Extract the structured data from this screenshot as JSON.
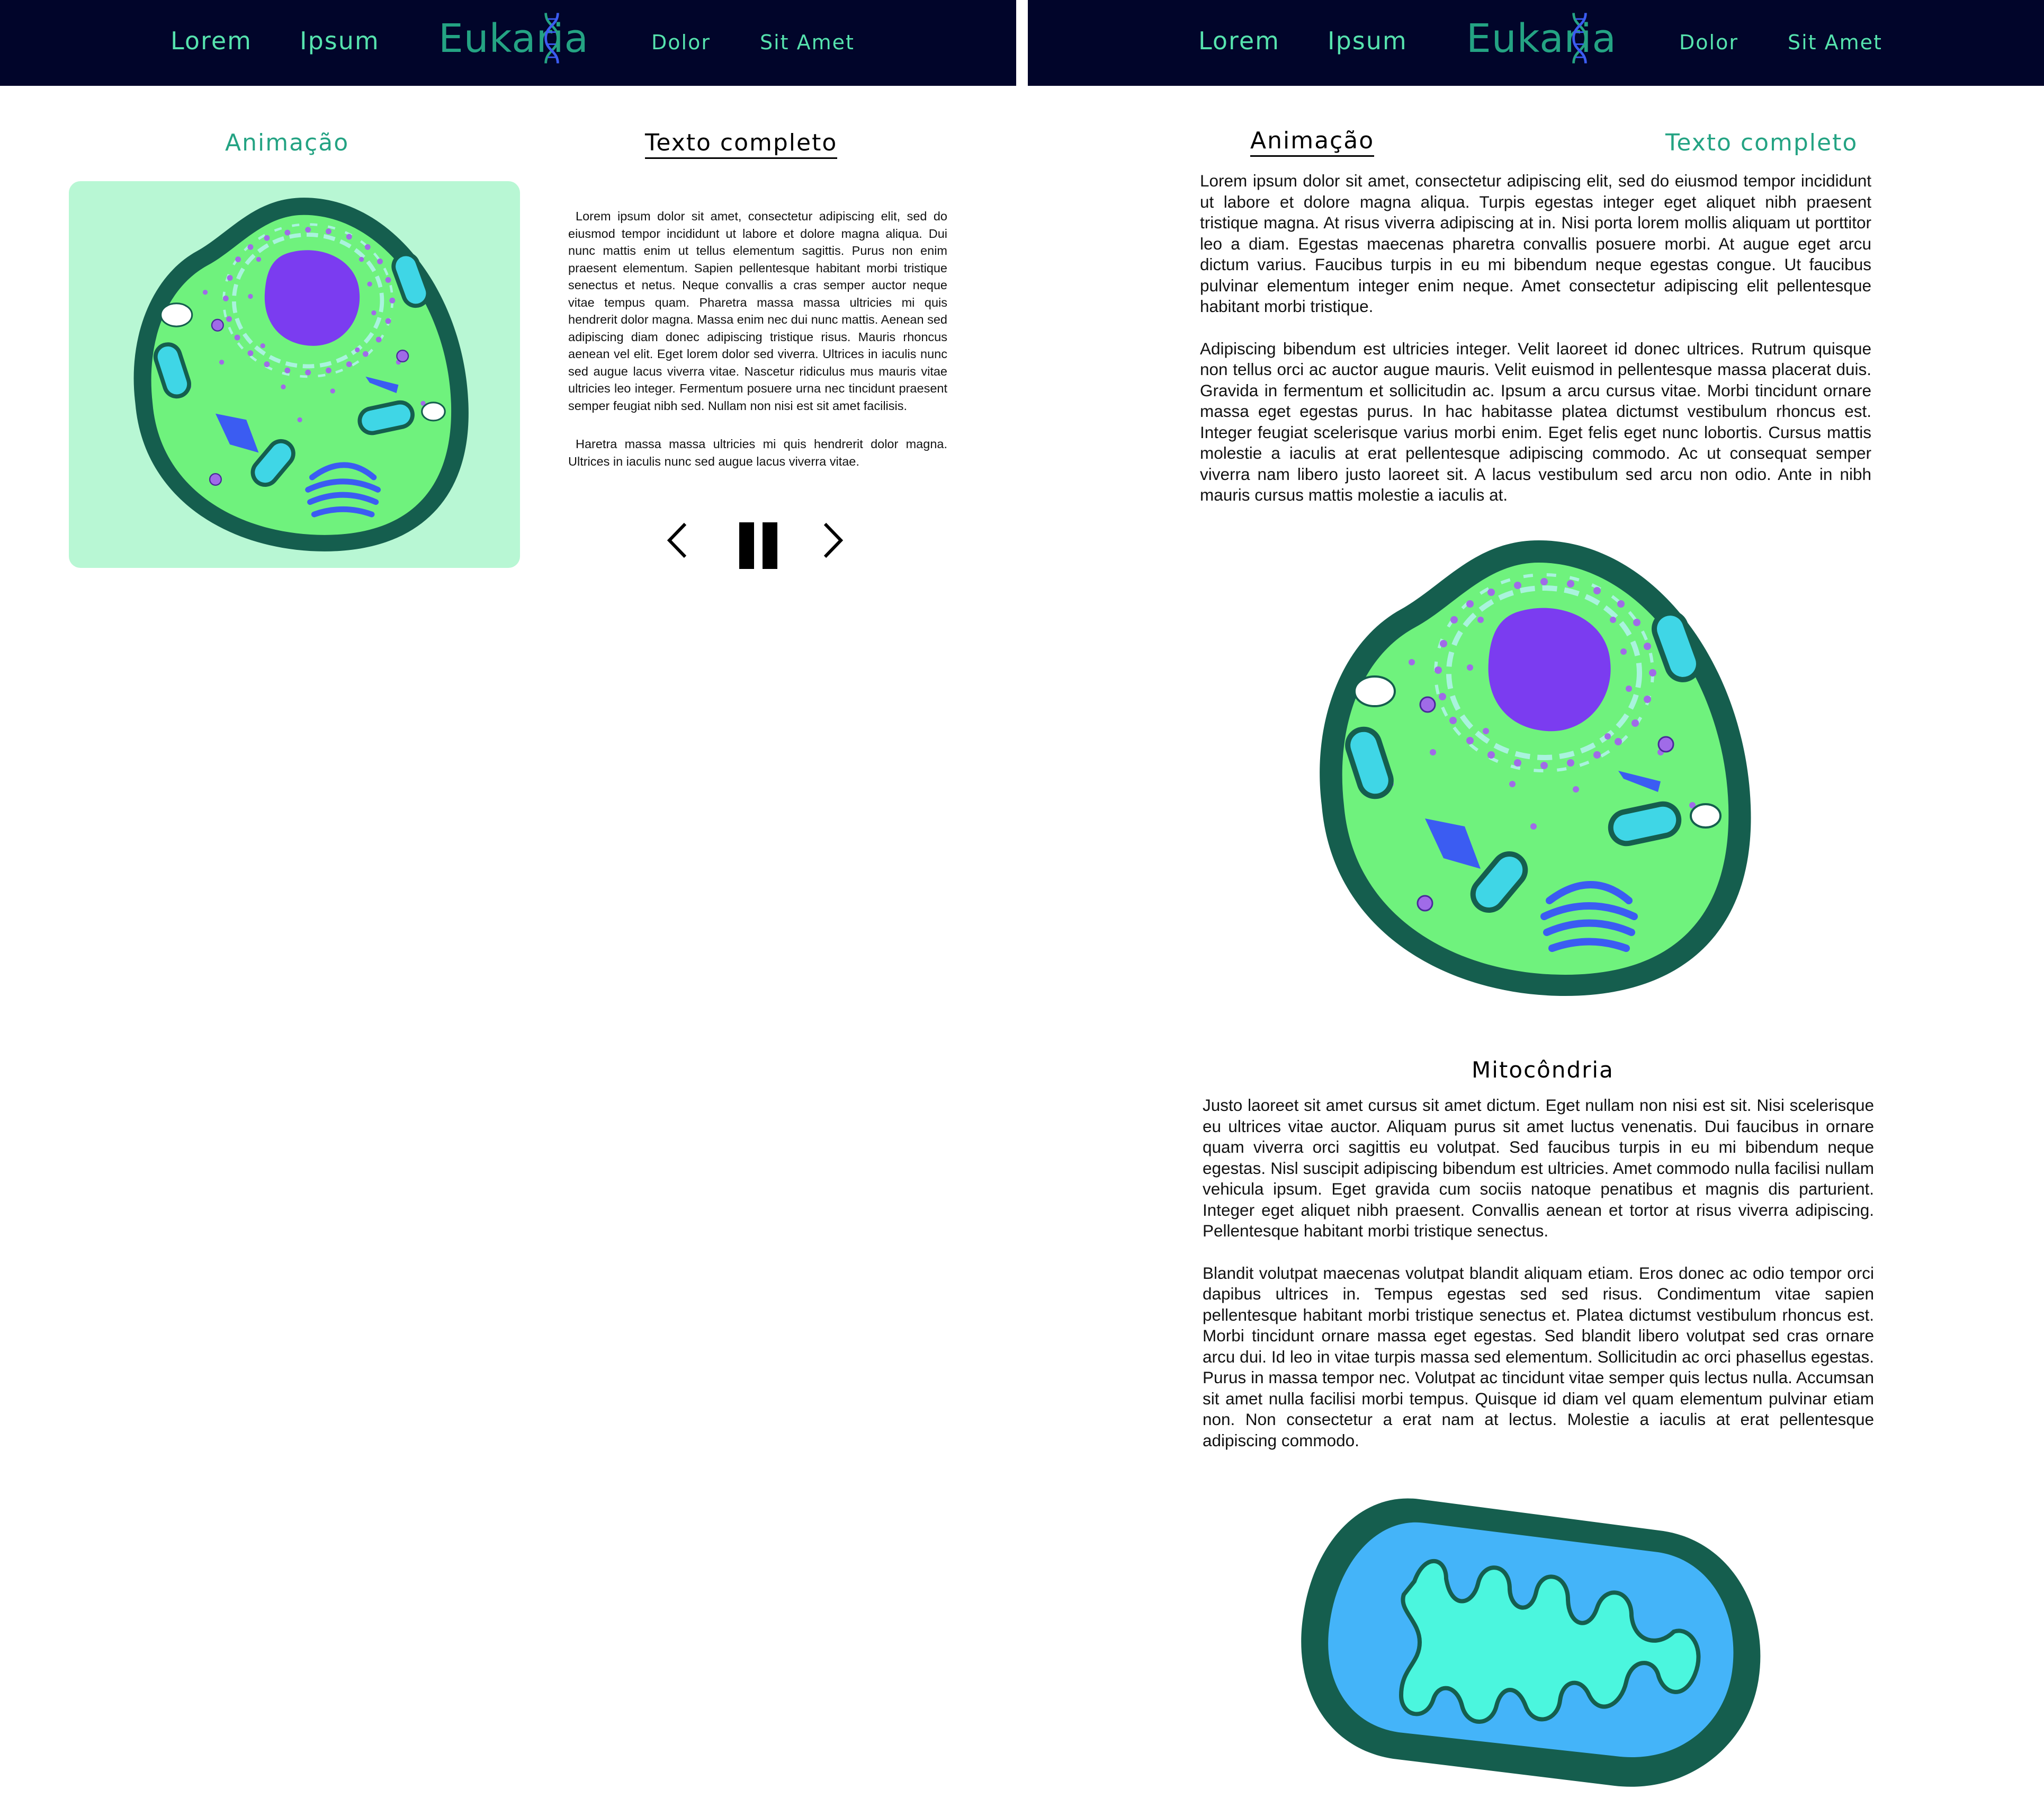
{
  "nav": {
    "links_left": [
      "Lorem",
      "Ipsum"
    ],
    "logo": "Eukaria",
    "links_right": [
      "Dolor",
      "Sit Amet"
    ]
  },
  "left_view": {
    "tabs": {
      "animation": "Animação",
      "full_text": "Texto completo"
    },
    "active_tab": "animation",
    "paragraphs": [
      "Lorem ipsum dolor sit amet, consectetur adipiscing elit, sed do eiusmod tempor incididunt ut labore et dolore magna aliqua. Dui nunc mattis enim ut tellus elementum sagittis. Purus non enim praesent elementum. Sapien pellentesque habitant morbi tristique senectus et netus. Neque convallis a cras semper auctor neque vitae tempus quam. Pharetra massa massa ultricies mi quis hendrerit dolor magna. Massa enim nec dui nunc mattis. Aenean sed adipiscing diam donec adipiscing tristique risus. Mauris rhoncus aenean vel elit. Eget lorem dolor sed viverra. Ultrices in iaculis nunc sed augue lacus viverra vitae. Nascetur ridiculus mus mauris vitae ultricies leo integer. Fermentum posuere urna nec tincidunt praesent semper feugiat nibh sed. Nullam non nisi est sit amet facilisis.",
      "Haretra massa massa ultricies mi quis hendrerit dolor magna. Ultrices in iaculis nunc sed augue lacus viverra vitae."
    ],
    "controls": {
      "prev": "chevron-left-icon",
      "pause": "pause-icon",
      "next": "chevron-right-icon"
    }
  },
  "right_view": {
    "tabs": {
      "animation": "Animação",
      "full_text": "Texto completo"
    },
    "active_tab": "full_text",
    "intro_paragraphs": [
      "Lorem ipsum dolor sit amet, consectetur adipiscing elit, sed do eiusmod tempor incididunt ut labore et dolore magna aliqua. Turpis egestas integer eget aliquet nibh praesent tristique magna. At risus viverra adipiscing at in. Nisi porta lorem mollis aliquam ut porttitor leo a diam. Egestas maecenas pharetra convallis posuere morbi. At augue eget arcu dictum varius. Faucibus turpis in eu mi bibendum neque egestas congue. Ut faucibus pulvinar elementum integer enim neque. Amet consectetur adipiscing elit pellentesque habitant morbi tristique.",
      "Adipiscing bibendum est ultricies integer. Velit laoreet id donec ultrices. Rutrum quisque non tellus orci ac auctor augue mauris. Velit euismod in pellentesque massa placerat duis. Gravida in fermentum et sollicitudin ac. Ipsum a arcu cursus vitae. Morbi tincidunt ornare massa eget egestas purus. In hac habitasse platea dictumst vestibulum rhoncus est. Integer feugiat scelerisque varius morbi enim. Eget felis eget nunc lobortis. Cursus mattis molestie a iaculis at erat pellentesque adipiscing commodo. Ac ut consequat semper viverra nam libero justo laoreet sit. A lacus vestibulum sed arcu non odio. Ante in nibh mauris cursus mattis molestie a iaculis at."
    ],
    "section_title": "Mitocôndria",
    "section_paragraphs": [
      "Justo laoreet sit amet cursus sit amet dictum. Eget nullam non nisi est sit. Nisi scelerisque eu ultrices vitae auctor. Aliquam purus sit amet luctus venenatis. Dui faucibus in ornare quam viverra orci sagittis eu volutpat. Sed faucibus turpis in eu mi bibendum neque egestas. Nisl suscipit adipiscing bibendum est ultricies. Amet commodo nulla facilisi nullam vehicula ipsum. Eget gravida cum sociis natoque penatibus et magnis dis parturient. Integer eget aliquet nibh praesent. Convallis aenean et tortor at risus viverra adipiscing. Pellentesque habitant morbi tristique senectus.",
      "Blandit volutpat maecenas volutpat blandit aliquam etiam. Eros donec ac odio tempor orci dapibus ultrices in. Tempus egestas sed sed risus. Condimentum vitae sapien pellentesque habitant morbi tristique senectus et. Platea dictumst vestibulum rhoncus est. Morbi tincidunt ornare massa eget egestas. Sed blandit libero volutpat sed cras ornare arcu dui. Id leo in vitae turpis massa sed elementum. Sollicitudin ac orci phasellus egestas. Purus in massa tempor nec. Volutpat ac tincidunt vitae semper quis lectus nulla. Accumsan sit amet nulla facilisi morbi tempus. Quisque id diam vel quam elementum pulvinar etiam non. Non consectetur a erat nam at lectus. Molestie a iaculis at erat pellentesque adipiscing commodo."
    ]
  },
  "colors": {
    "navbar_bg": "#01052a",
    "nav_link": "#56e3ae",
    "brand": "#24a383",
    "animation_bg": "#b8f7d4",
    "cell_membrane": "#155e4e",
    "cytoplasm": "#6ff27d",
    "nucleus": "#7b3cf0",
    "mitochondria_outer": "#155e4e",
    "mitochondria_inner": "#44b4f9",
    "cristae": "#4bf6de"
  }
}
